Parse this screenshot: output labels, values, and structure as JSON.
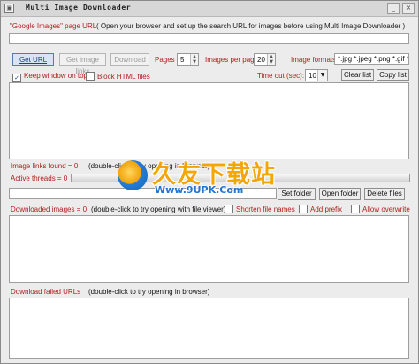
{
  "window": {
    "title": "Multi Image Downloader",
    "icon": "app-image-icon",
    "minimize": "_",
    "close": "×"
  },
  "top": {
    "instruction_label": "\"Google Images\" page URL",
    "instruction_hint": "( Open your browser and  set up the search URL for images before using Multi Image Downloader )",
    "url_value": ""
  },
  "controls": {
    "get_url": "Get URL",
    "get_image_links": "Get image links",
    "download": "Download",
    "pages_label": "Pages",
    "pages_value": "5",
    "images_per_page_label": "Images per page",
    "images_per_page_value": "20",
    "image_formats_label": "Image formats",
    "image_formats_value": "*.jpg *.jpeg *.png *.gif *.bm",
    "keep_window_on_top": "Keep window on top",
    "keep_window_checked": "✓",
    "block_html_files": "Block HTML files",
    "timeout_label": "Time out (sec):",
    "timeout_value": "10",
    "clear_list": "Clear list",
    "copy_list": "Copy list"
  },
  "status": {
    "image_links_found": "Image links found = 0",
    "image_links_hint": "(double-click to try opening in browser)",
    "active_threads": "Active threads = 0"
  },
  "folder": {
    "path_value": "",
    "set_folder": "Set folder",
    "open_folder": "Open folder",
    "delete_files": "Delete files"
  },
  "downloaded": {
    "label": "Downloaded images = 0",
    "hint": "(double-click to try opening with file viewer)",
    "shorten_file_names": "Shorten file names",
    "add_prefix": "Add prefix",
    "allow_overwrite": "Allow overwrite"
  },
  "failed": {
    "label": "Download failed URLs",
    "hint": "(double-click to try opening in browser)"
  },
  "watermark": {
    "logo_text": "久友下载站",
    "url": "Www.9UPK.Com"
  }
}
